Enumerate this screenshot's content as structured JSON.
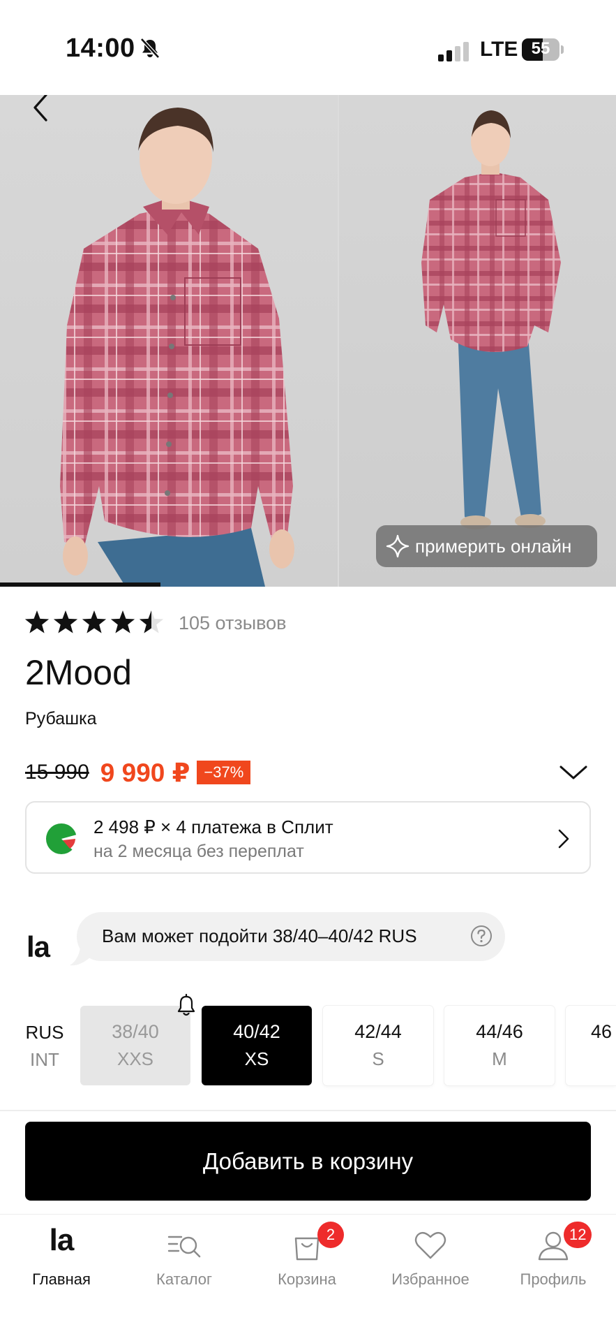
{
  "status_bar": {
    "time": "14:00",
    "network": "LTE",
    "battery_level": "55",
    "battery_percent": 55,
    "signal_bars_active": 2,
    "signal_bars_total": 4
  },
  "gallery": {
    "try_on_label": "примерить онлайн",
    "photo_count": 2,
    "current_index": 1
  },
  "product": {
    "rating": 4.5,
    "reviews": "105 отзывов",
    "brand": "2Mood",
    "type": "Рубашка",
    "old_price": "15 990",
    "new_price": "9 990 ₽",
    "discount": "−37%"
  },
  "split": {
    "title": "2 498 ₽ × 4 платежа в Сплит",
    "subtitle": "на 2 месяца без переплат"
  },
  "fit_hint": {
    "logo": "la",
    "text": "Вам может подойти 38/40–40/42 RUS"
  },
  "sizes": {
    "system_primary": "RUS",
    "system_secondary": "INT",
    "items": [
      {
        "rus": "38/40",
        "int": "XXS",
        "state": "unavailable"
      },
      {
        "rus": "40/42",
        "int": "XS",
        "state": "selected"
      },
      {
        "rus": "42/44",
        "int": "S",
        "state": "available"
      },
      {
        "rus": "44/46",
        "int": "M",
        "state": "available"
      },
      {
        "rus": "46",
        "int": "",
        "state": "available"
      }
    ]
  },
  "cta": {
    "add_to_cart": "Добавить в корзину"
  },
  "tab_bar": {
    "home_logo": "la",
    "items": [
      {
        "label": "Главная",
        "icon": "la-logo-icon",
        "badge": ""
      },
      {
        "label": "Каталог",
        "icon": "catalog-search-icon",
        "badge": ""
      },
      {
        "label": "Корзина",
        "icon": "shopping-bag-icon",
        "badge": "2"
      },
      {
        "label": "Избранное",
        "icon": "heart-icon",
        "badge": ""
      },
      {
        "label": "Профиль",
        "icon": "profile-icon",
        "badge": "12"
      }
    ]
  },
  "colors": {
    "accent": "#f0471d",
    "badge": "#ee2b2b",
    "primary": "#000000",
    "muted": "#8a8a8a"
  }
}
